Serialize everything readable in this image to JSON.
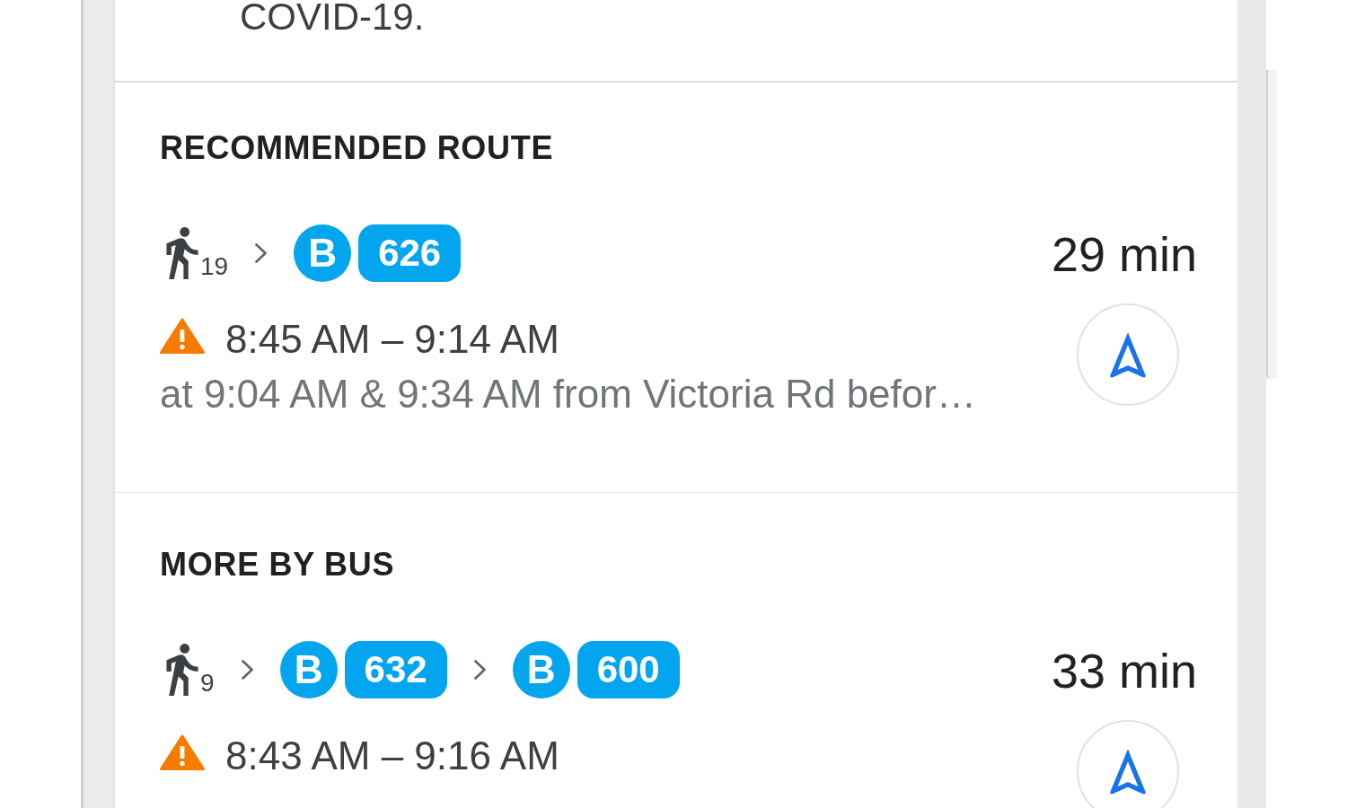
{
  "notice": {
    "text": "COVID-19."
  },
  "sections": [
    {
      "heading": "RECOMMENDED ROUTE",
      "routes": [
        {
          "legs": [
            {
              "kind": "walk",
              "minutes": "19"
            },
            {
              "kind": "bus",
              "badge": "B",
              "route": "626"
            }
          ],
          "duration": "29 min",
          "alert": true,
          "times": "8:45 AM – 9:14 AM",
          "details": "at 9:04 AM & 9:34 AM from Victoria Rd befor…"
        }
      ]
    },
    {
      "heading": "MORE BY BUS",
      "routes": [
        {
          "legs": [
            {
              "kind": "walk",
              "minutes": "9"
            },
            {
              "kind": "bus",
              "badge": "B",
              "route": "632"
            },
            {
              "kind": "bus",
              "badge": "B",
              "route": "600"
            }
          ],
          "duration": "33 min",
          "alert": true,
          "times": "8:43 AM – 9:16 AM"
        }
      ]
    }
  ]
}
